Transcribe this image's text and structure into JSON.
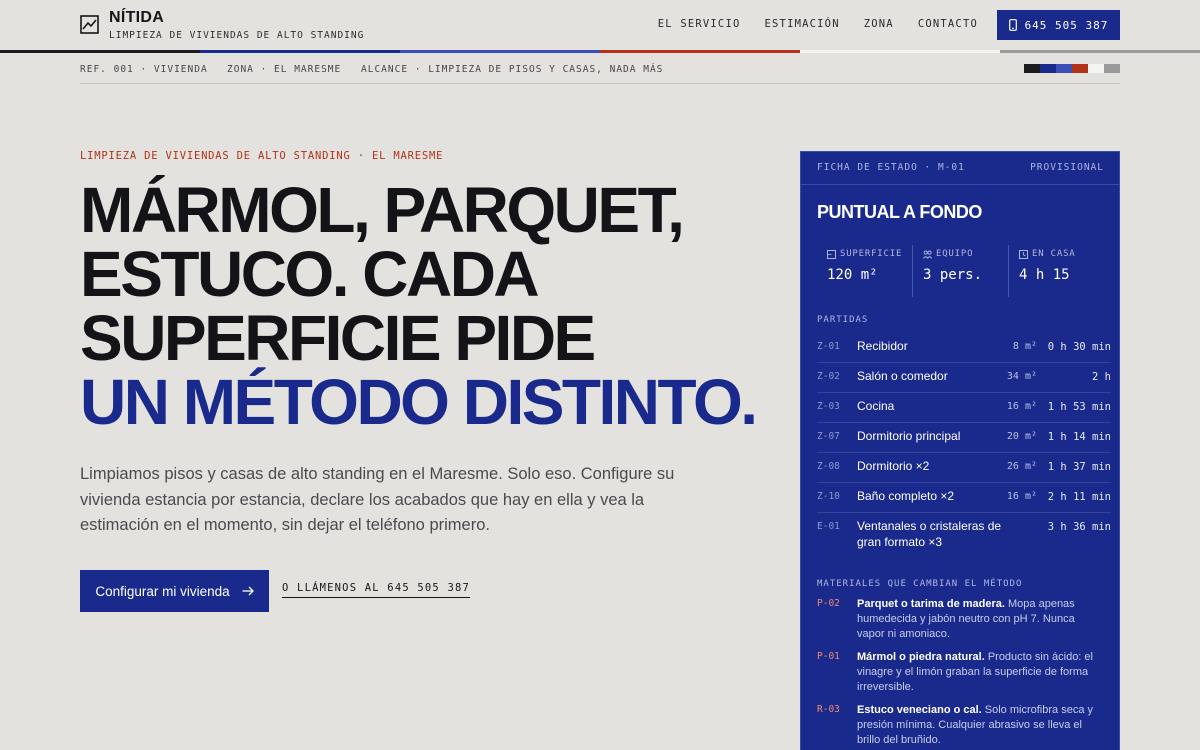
{
  "brand": {
    "name": "NÍTIDA",
    "tagline": "LIMPIEZA DE VIVIENDAS DE ALTO STANDING"
  },
  "nav": {
    "items": [
      "EL SERVICIO",
      "ESTIMACIÓN",
      "ZONA",
      "CONTACTO"
    ],
    "phone": "645 505 387"
  },
  "colors": {
    "ink": "#16161a",
    "accent_blue": "#1a2a8c",
    "accent_red": "#b3321a",
    "background": "#e3e2de",
    "stripe": [
      "#1c1c20",
      "#1a2a8c",
      "#3b4fb8",
      "#b3321a",
      "#f4f4f2",
      "#9a9a9a"
    ]
  },
  "refbar": {
    "ref": "REF. 001 · VIVIENDA",
    "zona": "ZONA · EL MARESME",
    "alcance": "ALCANCE · LIMPIEZA DE PISOS Y CASAS, NADA MÁS"
  },
  "hero": {
    "eyebrow": "LIMPIEZA DE VIVIENDAS DE ALTO STANDING · EL MARESME",
    "headline_lines": [
      "MÁRMOL, PARQUET,",
      "ESTUCO. CADA",
      "SUPERFICIE PIDE"
    ],
    "headline_accent": "UN MÉTODO DISTINTO.",
    "lede": "Limpiamos pisos y casas de alto standing en el Maresme. Solo eso. Configure su vivienda estancia por estancia, declare los acabados que hay en ella y vea la estimación en el momento, sin dejar el teléfono primero.",
    "cta_label": "Configurar mi vivienda",
    "call_label": "O LLÁMENOS AL 645 505 387"
  },
  "panel": {
    "header_left": "FICHA DE ESTADO · M-01",
    "header_right": "PROVISIONAL",
    "title": "PUNTUAL A FONDO",
    "stats": [
      {
        "label": "SUPERFICIE",
        "value": "120 m²",
        "icon": "area-icon"
      },
      {
        "label": "EQUIPO",
        "value": "3 pers.",
        "icon": "team-icon"
      },
      {
        "label": "EN CASA",
        "value": "4 h 15",
        "icon": "clock-icon"
      }
    ],
    "partidas_label": "PARTIDAS",
    "items": [
      {
        "code": "Z-01",
        "name": "Recibidor",
        "area": "8 m²",
        "time": "0 h 30 min"
      },
      {
        "code": "Z-02",
        "name": "Salón o comedor",
        "area": "34 m²",
        "time": "2 h"
      },
      {
        "code": "Z-03",
        "name": "Cocina",
        "area": "16 m²",
        "time": "1 h 53 min"
      },
      {
        "code": "Z-07",
        "name": "Dormitorio principal",
        "area": "20 m²",
        "time": "1 h 14 min"
      },
      {
        "code": "Z-08",
        "name": "Dormitorio ×2",
        "area": "26 m²",
        "time": "1 h 37 min"
      },
      {
        "code": "Z-10",
        "name": "Baño completo ×2",
        "area": "16 m²",
        "time": "2 h 11 min"
      },
      {
        "code": "E-01",
        "name": "Ventanales o cristaleras de gran formato ×3",
        "area": "",
        "time": "3 h 36 min"
      }
    ],
    "materials_label": "MATERIALES QUE CAMBIAN EL MÉTODO",
    "materials": [
      {
        "code": "P-02",
        "title": "Parquet o tarima de madera.",
        "text": "Mopa apenas humedecida y jabón neutro con pH 7. Nunca vapor ni amoniaco."
      },
      {
        "code": "P-01",
        "title": "Mármol o piedra natural.",
        "text": "Producto sin ácido: el vinagre y el limón graban la superficie de forma irreversible."
      },
      {
        "code": "R-03",
        "title": "Estuco veneciano o cal.",
        "text": "Solo microfibra seca y presión mínima. Cualquier abrasivo se lleva el brillo del bruñido."
      }
    ]
  }
}
